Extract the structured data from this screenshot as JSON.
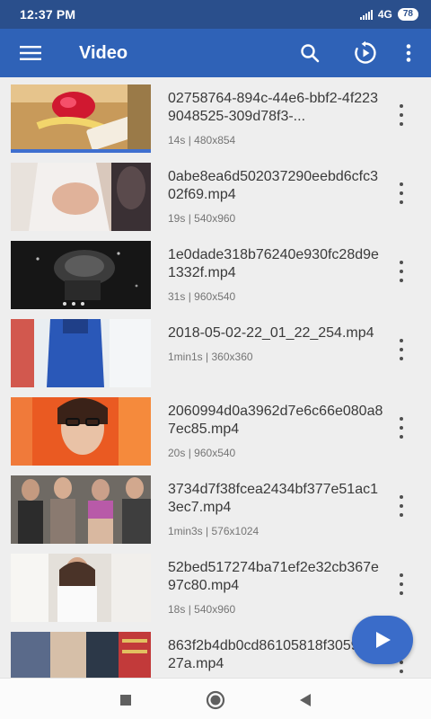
{
  "status": {
    "time": "12:37 PM",
    "network": "4G",
    "battery": "78"
  },
  "app_bar": {
    "title": "Video",
    "icons": [
      "menu-icon",
      "search-icon",
      "resume-play-icon",
      "more-vert-icon"
    ]
  },
  "videos": [
    {
      "name": "02758764-894c-44e6-bbf2-4f2239048525-309d78f3-...",
      "duration": "14s",
      "resolution": "480x854"
    },
    {
      "name": "0abe8ea6d502037290eebd6cfc302f69.mp4",
      "duration": "19s",
      "resolution": "540x960"
    },
    {
      "name": "1e0dade318b76240e930fc28d9e1332f.mp4",
      "duration": "31s",
      "resolution": "960x540"
    },
    {
      "name": "2018-05-02-22_01_22_254.mp4",
      "duration": "1min1s",
      "resolution": "360x360"
    },
    {
      "name": "2060994d0a3962d7e6c66e080a87ec85.mp4",
      "duration": "20s",
      "resolution": "960x540"
    },
    {
      "name": "3734d7f38fcea2434bf377e51ac13ec7.mp4",
      "duration": "1min3s",
      "resolution": "576x1024"
    },
    {
      "name": "52bed517274ba71ef2e32cb367e97c80.mp4",
      "duration": "18s",
      "resolution": "540x960"
    },
    {
      "name": "863f2b4db0cd86105818f3059f0d27a.mp4",
      "duration": "",
      "resolution": ""
    }
  ],
  "meta_separator": "|",
  "fab": {
    "icon": "play-icon"
  },
  "nav": {
    "icons": [
      "recent-apps-icon",
      "home-icon",
      "back-icon"
    ]
  },
  "colors": {
    "status_bar": "#2a4f8c",
    "app_bar": "#2f62b7",
    "fab": "#3a6cc9",
    "list_bg": "#eeeeee"
  }
}
